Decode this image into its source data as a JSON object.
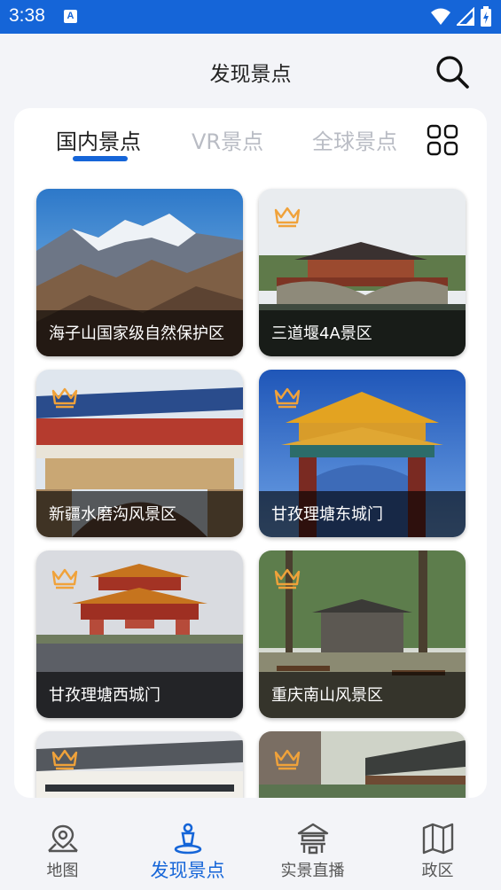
{
  "status_bar": {
    "time": "3:38",
    "notif_letter": "A"
  },
  "header": {
    "title": "发现景点",
    "search_icon": "search-icon"
  },
  "tabs": [
    {
      "label": "国内景点",
      "active": true
    },
    {
      "label": "VR景点",
      "active": false
    },
    {
      "label": "全球景点",
      "active": false
    }
  ],
  "grid_icon": "grid-icon",
  "spots": [
    {
      "name": "海子山国家级自然保护区",
      "premium": false
    },
    {
      "name": "三道堰4A景区",
      "premium": true
    },
    {
      "name": "新疆水磨沟风景区",
      "premium": true
    },
    {
      "name": "甘孜理塘东城门",
      "premium": true
    },
    {
      "name": "甘孜理塘西城门",
      "premium": true
    },
    {
      "name": "重庆南山风景区",
      "premium": true
    },
    {
      "name": "",
      "premium": true
    },
    {
      "name": "",
      "premium": true
    }
  ],
  "bottom_nav": [
    {
      "label": "地图",
      "icon": "map-pin-icon",
      "active": false
    },
    {
      "label": "发现景点",
      "icon": "discover-person-icon",
      "active": true
    },
    {
      "label": "实景直播",
      "icon": "pavilion-icon",
      "active": false
    },
    {
      "label": "政区",
      "icon": "region-map-icon",
      "active": false
    }
  ],
  "colors": {
    "accent": "#1565d8",
    "crown": "#f0a23a",
    "inactive_tab": "#b9bcc4"
  }
}
